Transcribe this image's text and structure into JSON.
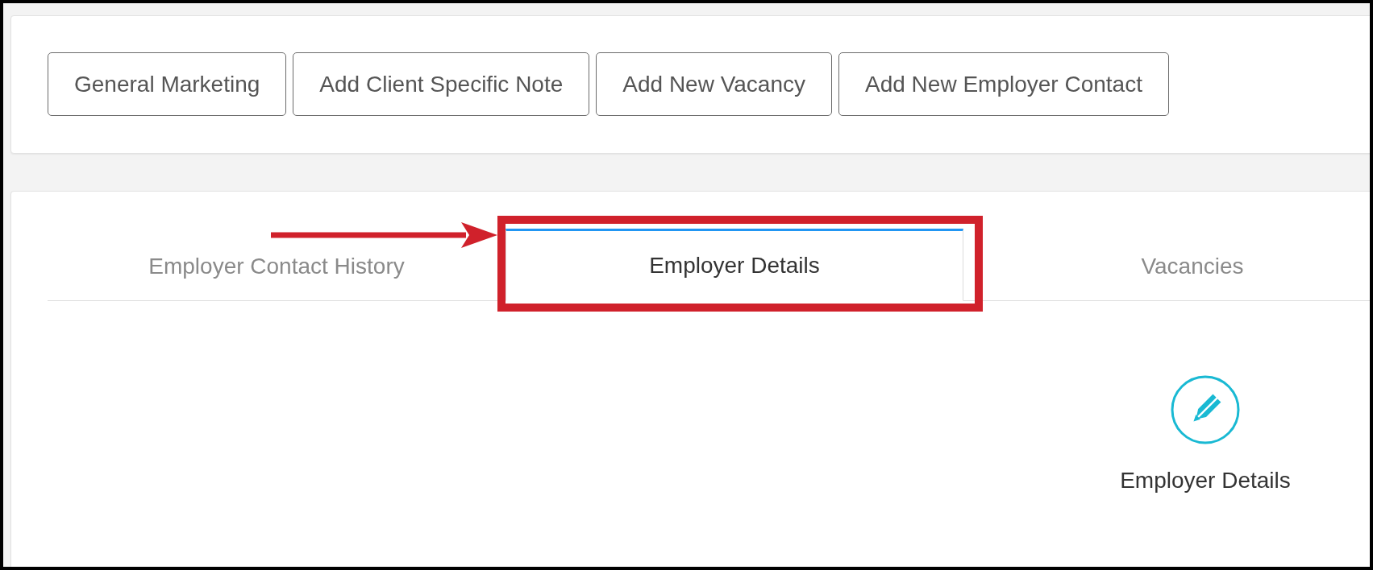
{
  "toolbar": {
    "buttons": [
      "General Marketing",
      "Add Client Specific Note",
      "Add New Vacancy",
      "Add New Employer Contact"
    ]
  },
  "tabs": [
    {
      "label": "Employer Contact History",
      "selected": false
    },
    {
      "label": "Employer Details",
      "selected": true
    },
    {
      "label": "Vacancies",
      "selected": false
    }
  ],
  "tab_panel": {
    "items": [
      {
        "label": "Employer Details"
      }
    ]
  }
}
